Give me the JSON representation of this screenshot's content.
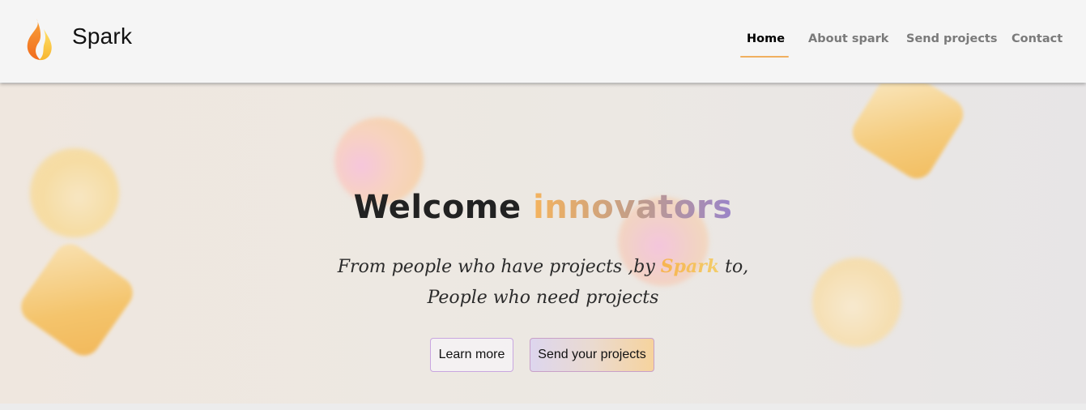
{
  "brand": {
    "name": "Spark",
    "logo_icon": "flame-icon"
  },
  "nav": {
    "items": [
      {
        "label": "Home",
        "active": true
      },
      {
        "label": "About spark",
        "active": false
      },
      {
        "label": "Send projects",
        "active": false
      },
      {
        "label": "Contact",
        "active": false
      }
    ]
  },
  "hero": {
    "title_part1": "Welcome",
    "title_part2": "innovators",
    "subtitle_line1_before": "From people who have projects ,by",
    "subtitle_line1_highlight": "Spark",
    "subtitle_line1_after": "to,",
    "subtitle_line2": "People who need projects",
    "buttons": {
      "learn_more": "Learn more",
      "send_projects": "Send your projects"
    }
  },
  "colors": {
    "accent_orange": "#f4b35e",
    "accent_purple": "#9a84c8",
    "active_underline": "#f0b060"
  }
}
